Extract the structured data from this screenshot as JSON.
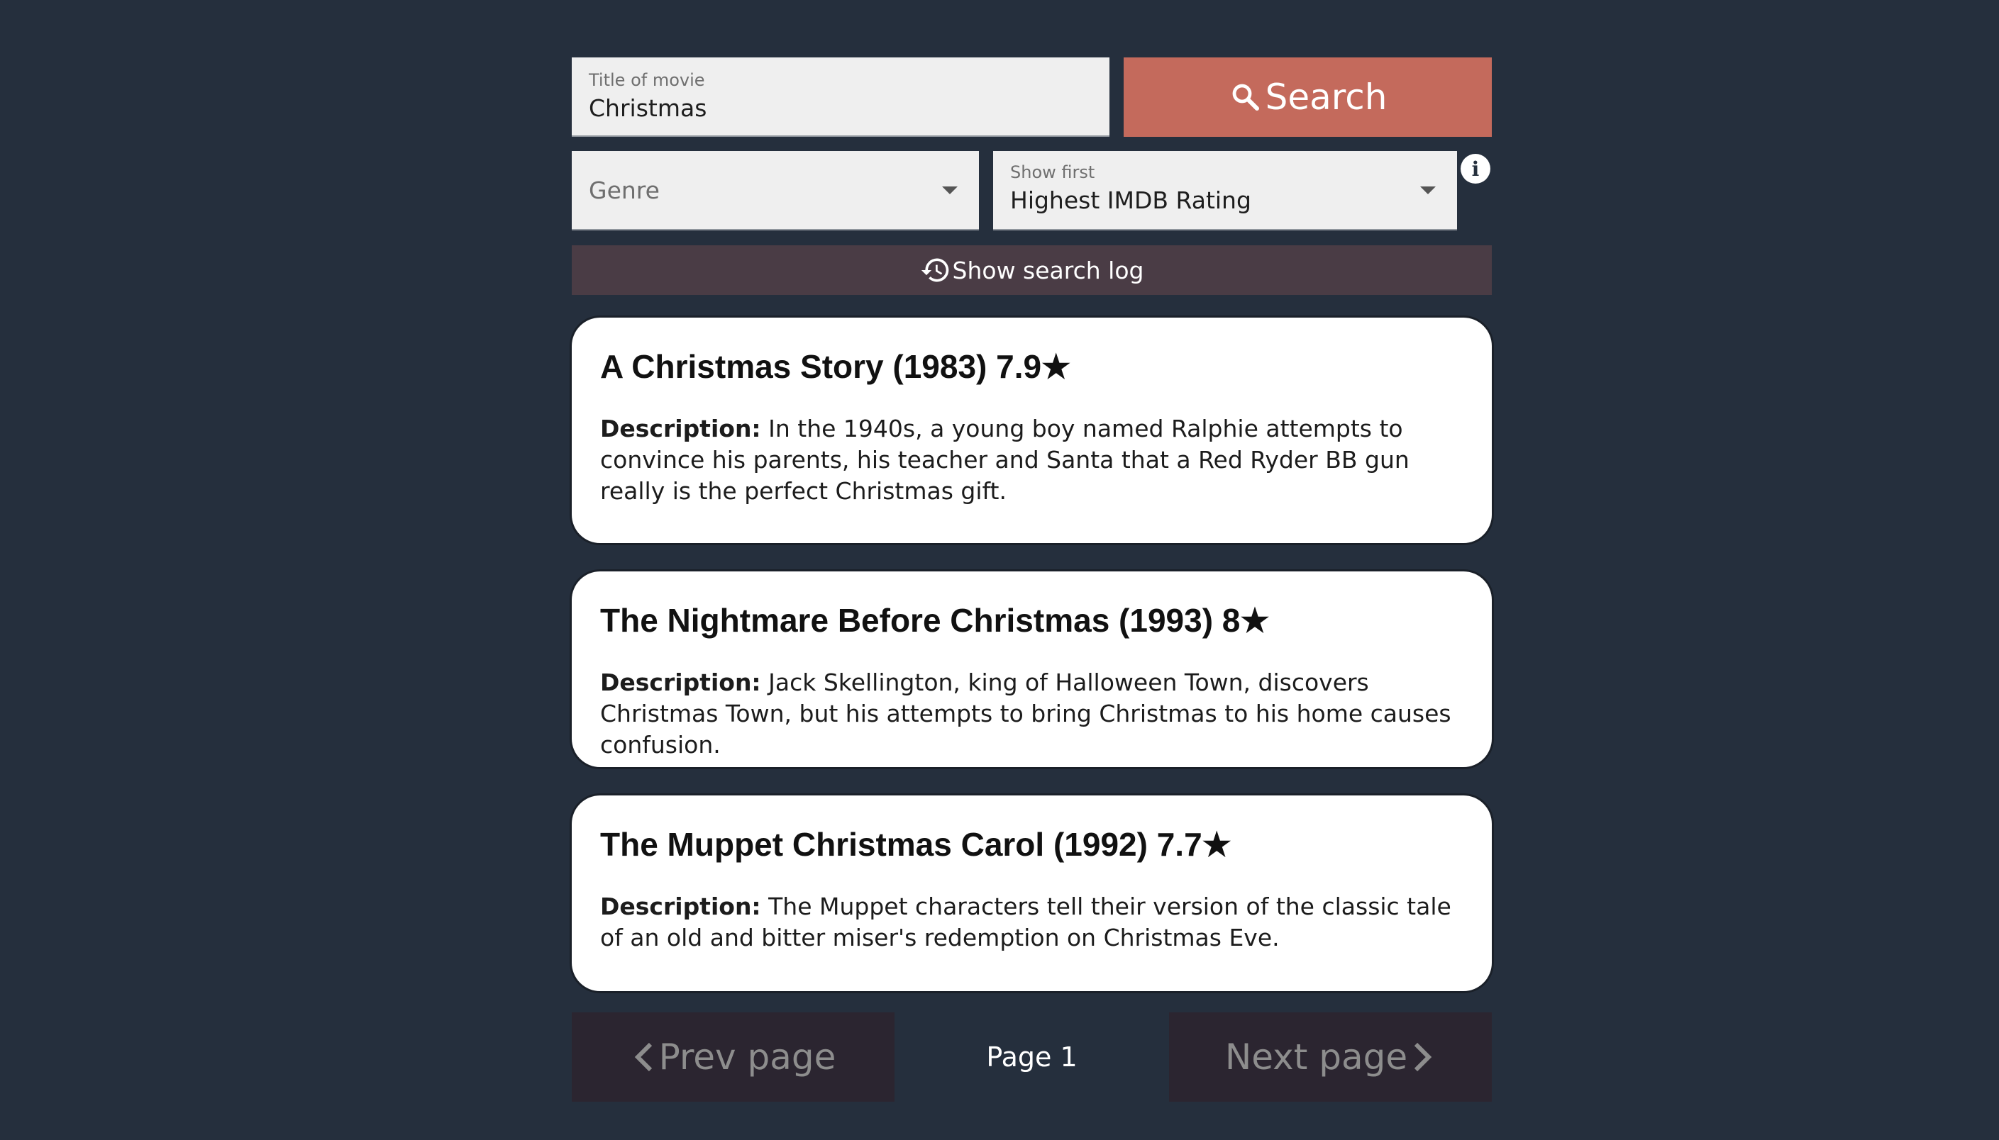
{
  "search": {
    "title_label": "Title of movie",
    "title_value": "Christmas",
    "button_label": "Search"
  },
  "filters": {
    "genre_placeholder": "Genre",
    "show_first_label": "Show first",
    "show_first_value": "Highest IMDB Rating",
    "info_glyph": "i"
  },
  "log": {
    "button_label": "Show search log"
  },
  "results": [
    {
      "title": "A Christmas Story (1983) 7.9★",
      "desc_label": "Description:",
      "description": " In the 1940s, a young boy named Ralphie attempts to convince his parents, his teacher and Santa that a Red Ryder BB gun really is the perfect Christmas gift."
    },
    {
      "title": "The Nightmare Before Christmas (1993) 8★",
      "desc_label": "Description:",
      "description": " Jack Skellington, king of Halloween Town, discovers Christmas Town, but his attempts to bring Christmas to his home causes confusion."
    },
    {
      "title": "The Muppet Christmas Carol (1992) 7.7★",
      "desc_label": "Description:",
      "description": " The Muppet characters tell their version of the classic tale of an old and bitter miser's redemption on Christmas Eve."
    }
  ],
  "pagination": {
    "prev_label": "Prev page",
    "page_label": "Page 1",
    "next_label": "Next page"
  },
  "colors": {
    "background": "#252f3d",
    "search_button": "#c46a5c",
    "log_button": "#4a3c45",
    "pager_button": "#2b2530"
  }
}
